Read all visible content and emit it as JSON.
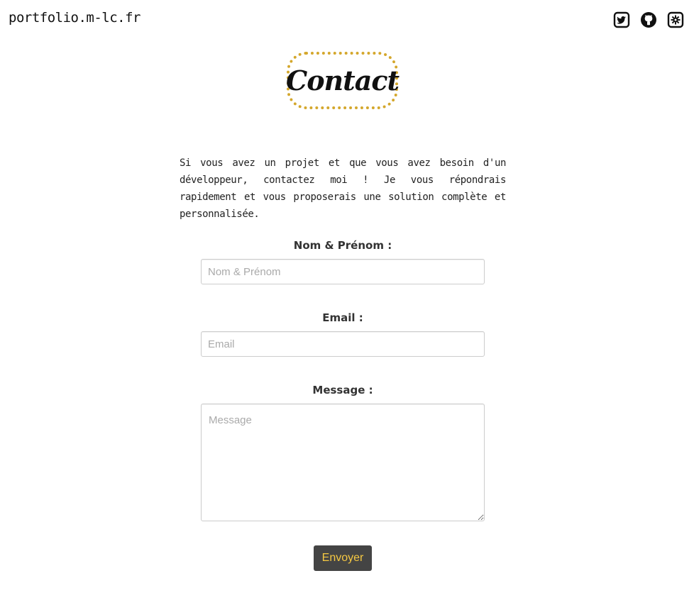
{
  "header": {
    "site_name": "portfolio.m-lc.fr",
    "social_icons": [
      {
        "icon": "twitter-icon"
      },
      {
        "icon": "github-icon"
      },
      {
        "icon": "settings-icon"
      }
    ]
  },
  "main": {
    "title": "Contact",
    "intro": "Si vous avez un projet et que vous avez besoin d'un développeur, contactez moi ! Je vous répondrais rapidement et vous proposerais une solution complète et personnalisée."
  },
  "form": {
    "name": {
      "label": "Nom & Prénom :",
      "value": "",
      "placeholder": "Nom & Prénom"
    },
    "email": {
      "label": "Email :",
      "value": "",
      "placeholder": "Email"
    },
    "message": {
      "label": "Message :",
      "value": "",
      "placeholder": "Message"
    },
    "submit_label": "Envoyer"
  },
  "colors": {
    "accent": "#d4a72c",
    "button_bg": "#444444",
    "button_text": "#f5c842"
  }
}
